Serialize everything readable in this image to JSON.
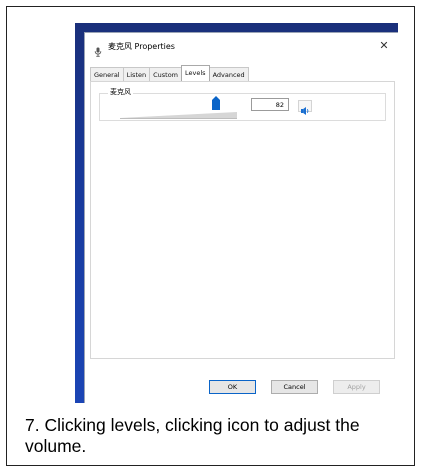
{
  "dialog": {
    "title": "麦克风 Properties",
    "close_symbol": "✕",
    "tabs": [
      "General",
      "Listen",
      "Custom",
      "Levels",
      "Advanced"
    ],
    "active_tab": "Levels",
    "group_label": "麦克风",
    "level_value": "82",
    "level_fraction": 0.82,
    "buttons": {
      "ok": "OK",
      "cancel": "Cancel",
      "apply": "Apply"
    },
    "icons": {
      "title": "microphone-icon",
      "speaker": "speaker-icon",
      "slider_thumb": "slider-thumb"
    }
  },
  "caption": {
    "text": "7. Clicking levels, clicking icon to adjust the volume."
  },
  "colors": {
    "desktop": "#1b45b5",
    "slider_thumb": "#0a64c8",
    "speaker_icon": "#1a6fd1",
    "ok_border": "#0a64c8"
  }
}
